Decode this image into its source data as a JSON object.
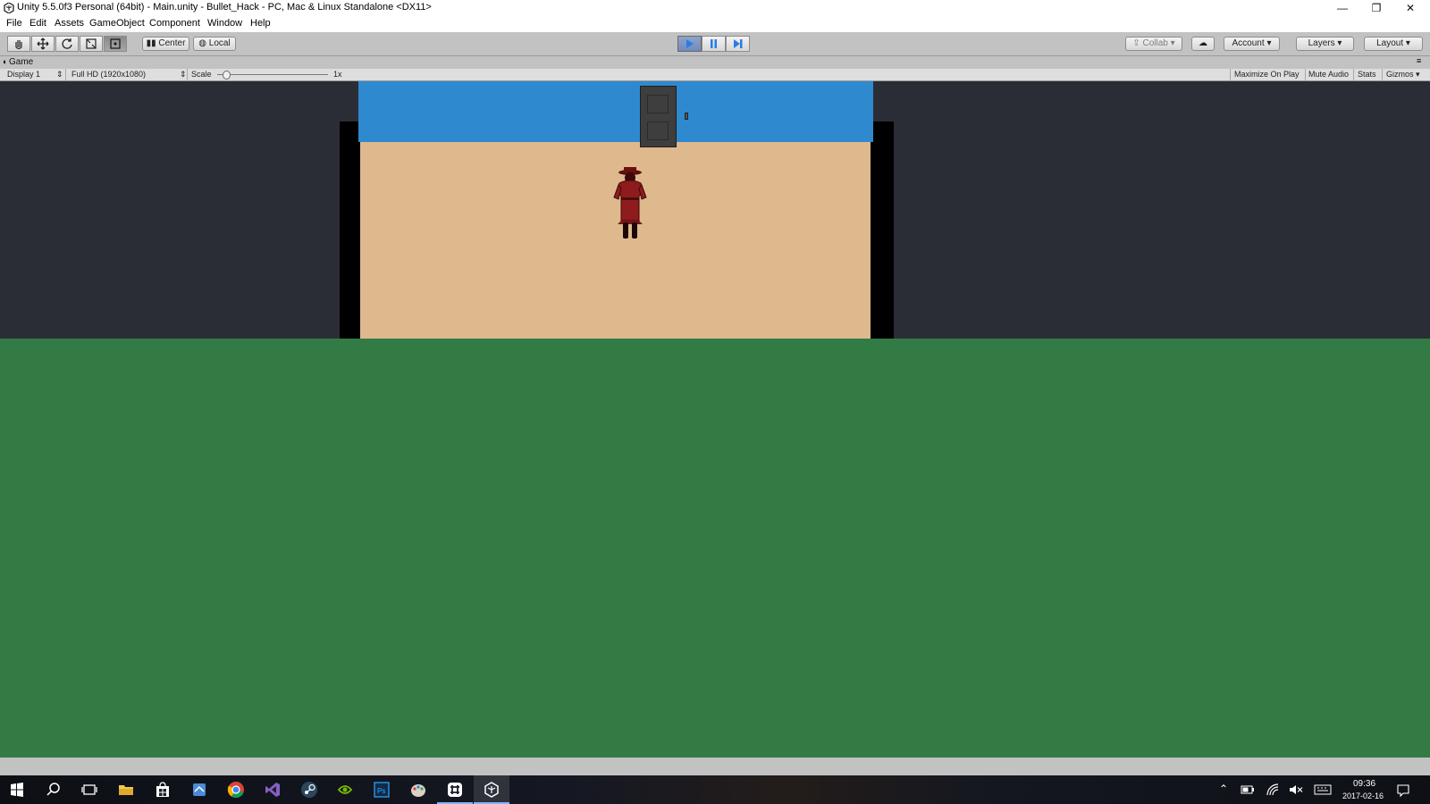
{
  "window": {
    "title": "Unity 5.5.0f3 Personal (64bit) - Main.unity - Bullet_Hack - PC, Mac & Linux Standalone <DX11>",
    "minimize_glyph": "—",
    "restore_glyph": "❐",
    "close_glyph": "✕"
  },
  "menubar": {
    "items": [
      "File",
      "Edit",
      "Assets",
      "GameObject",
      "Component",
      "Window",
      "Help"
    ]
  },
  "toolbar": {
    "tools": [
      "hand-icon",
      "move-icon",
      "rotate-icon",
      "scale-icon",
      "rect-tool-icon"
    ],
    "active_tool": "rect-tool-icon",
    "pivot_label": "Center",
    "space_label": "Local",
    "play_active": true,
    "collab_label": "Collab",
    "account_label": "Account",
    "layers_label": "Layers",
    "layout_label": "Layout"
  },
  "game_view": {
    "tab_label": "Game",
    "display_label": "Display 1",
    "resolution_label": "Full HD (1920x1080)",
    "scale_label": "Scale",
    "scale_value": "1x",
    "scale_slider_fraction": 0.08,
    "maximize_label": "Maximize On Play",
    "mute_label": "Mute Audio",
    "stats_label": "Stats",
    "gizmos_label": "Gizmos"
  },
  "scene_colors": {
    "background": "#2b2d36",
    "ground": "#337b45",
    "wall": "#2f89cf",
    "floor": "#dfb98e",
    "door": "#3e3e3e",
    "player": "#8e1c1c"
  },
  "taskbar": {
    "apps": [
      "windows-start-icon",
      "search-icon",
      "task-view-icon",
      "file-explorer-icon",
      "store-icon",
      "app-icon",
      "chrome-icon",
      "visual-studio-icon",
      "steam-icon",
      "geforce-icon",
      "photoshop-icon",
      "paint-icon",
      "slack-icon",
      "unity-icon"
    ],
    "time": "09:36",
    "date": "2017-02-16"
  }
}
